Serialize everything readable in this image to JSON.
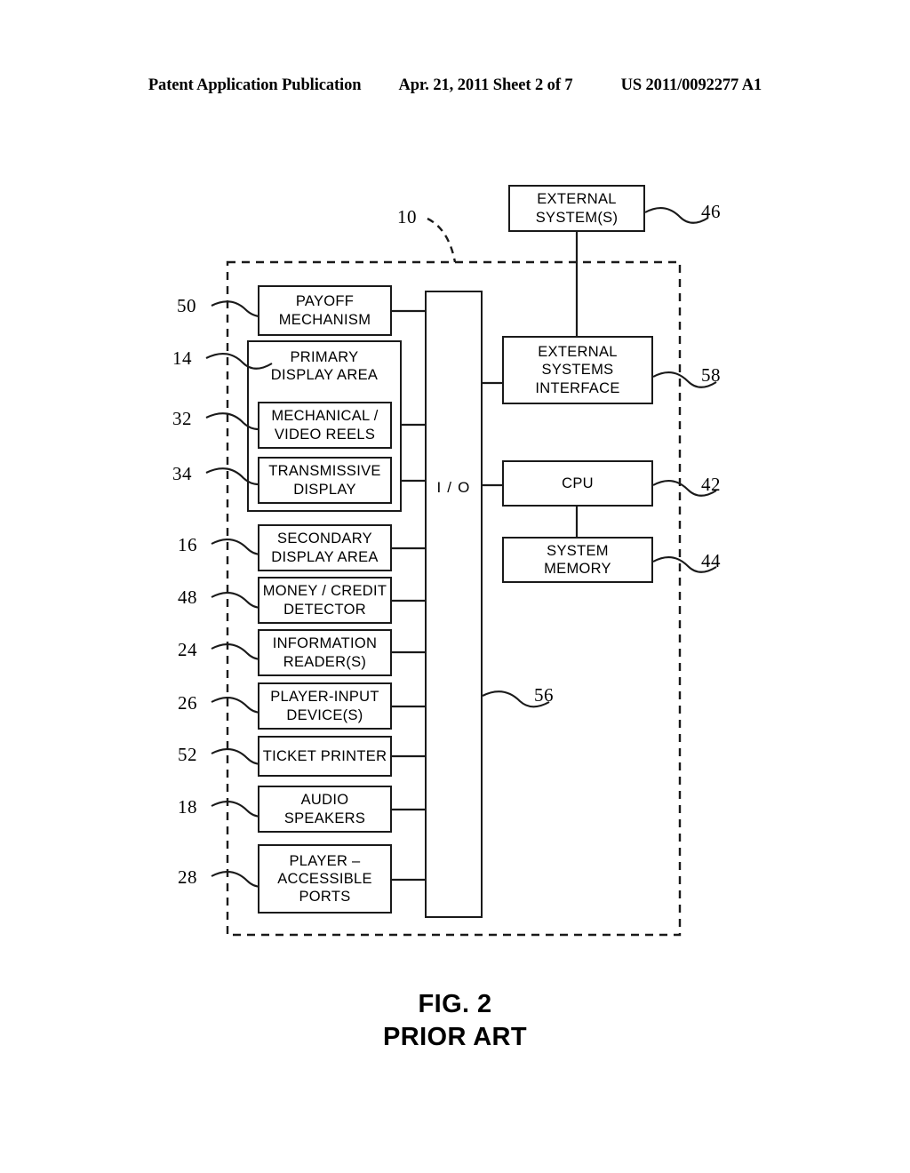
{
  "header": {
    "publication": "Patent Application Publication",
    "date_sheet": "Apr. 21, 2011  Sheet 2 of 7",
    "patent_number": "US 2011/0092277 A1"
  },
  "caption": {
    "figure": "FIG. 2",
    "note": "PRIOR ART",
    "full": "FIG. 2\nPRIOR ART"
  },
  "diagram": {
    "enclosure_ref": "10",
    "enclosure_style": "dashed",
    "io_bus": {
      "label": "I / O",
      "ref": "56"
    },
    "external_node": {
      "label": "EXTERNAL\nSYSTEM(S)",
      "ref": "46"
    },
    "left_nodes": [
      {
        "label": "PAYOFF\nMECHANISM",
        "ref": "50"
      },
      {
        "label": "PRIMARY\nDISPLAY  AREA",
        "ref": "14"
      },
      {
        "label": "MECHANICAL /\nVIDEO  REELS",
        "ref": "32"
      },
      {
        "label": "TRANSMISSIVE\nDISPLAY",
        "ref": "34"
      },
      {
        "label": "SECONDARY\nDISPLAY  AREA",
        "ref": "16"
      },
      {
        "label": "MONEY / CREDIT\nDETECTOR",
        "ref": "48"
      },
      {
        "label": "INFORMATION\nREADER(S)",
        "ref": "24"
      },
      {
        "label": "PLAYER-INPUT\nDEVICE(S)",
        "ref": "26"
      },
      {
        "label": "TICKET  PRINTER",
        "ref": "52"
      },
      {
        "label": "AUDIO\nSPEAKERS",
        "ref": "18"
      },
      {
        "label": "PLAYER  –\nACCESSIBLE\nPORTS",
        "ref": "28"
      }
    ],
    "right_nodes": [
      {
        "label": "EXTERNAL\nSYSTEMS\nINTERFACE",
        "ref": "58"
      },
      {
        "label": "CPU",
        "ref": "42"
      },
      {
        "label": "SYSTEM\nMEMORY",
        "ref": "44"
      }
    ],
    "colors": {
      "line": "#1a1a1a",
      "background": "#ffffff"
    }
  }
}
